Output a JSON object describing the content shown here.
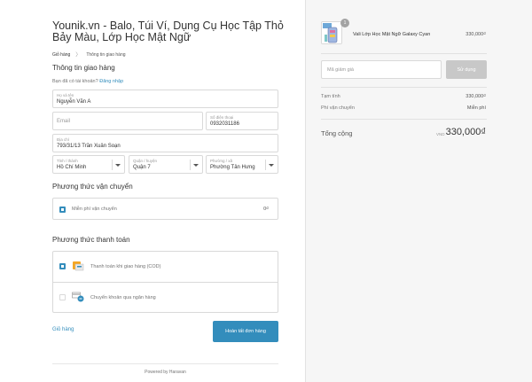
{
  "shop": {
    "title": "Younik.vn - Balo, Túi Ví, Dụng Cụ Học Tập Thỏ Bảy Màu, Lớp Học Mật Ngữ"
  },
  "breadcrumb": {
    "cart": "Giỏ hàng",
    "separator": "〉",
    "current": "Thông tin giao hàng"
  },
  "shipping_info": {
    "title": "Thông tin giao hàng",
    "login_prompt": "Bạn đã có tài khoản?",
    "login_link": "Đăng nhập",
    "name": {
      "label": "Họ và tên",
      "value": "Nguyễn Văn A"
    },
    "email": {
      "placeholder": "Email"
    },
    "phone": {
      "label": "Số điện thoại",
      "value": "0932031186"
    },
    "address": {
      "label": "Địa chỉ",
      "value": "793/31/13 Trần Xuân Soạn"
    },
    "province": {
      "label": "Tỉnh / thành",
      "value": "Hồ Chí Minh"
    },
    "district": {
      "label": "Quận / huyện",
      "value": "Quận 7"
    },
    "ward": {
      "label": "Phường / xã",
      "value": "Phường Tân Hưng"
    }
  },
  "shipping_method": {
    "title": "Phương thức vận chuyển",
    "option_label": "Miễn phí vận chuyển",
    "option_price": "0₫"
  },
  "payment_method": {
    "title": "Phương thức thanh toán",
    "cod_label": "Thanh toán khi giao hàng (COD)",
    "bank_label": "Chuyển khoản qua ngân hàng"
  },
  "actions": {
    "cart_link": "Giỏ hàng",
    "finish_button": "Hoàn tất đơn hàng"
  },
  "footer": {
    "powered_by": "Powered by Haravan"
  },
  "order": {
    "product": {
      "name": "Vali Lớp Học Mật Ngữ Galaxy Cyan",
      "quantity": "1",
      "price": "330,000₫"
    },
    "discount_placeholder": "Mã giảm giá",
    "apply_button": "Sử dụng",
    "subtotal_label": "Tạm tính",
    "subtotal_value": "330,000₫",
    "shipping_label": "Phí vận chuyển",
    "shipping_value": "Miễn phí",
    "total_label": "Tổng cộng",
    "total_currency": "VND",
    "total_value": "330,000₫"
  },
  "colors": {
    "accent": "#338dbc",
    "sidebar_bg": "#f6f6f6",
    "apply_disabled": "#c8c8c8"
  }
}
